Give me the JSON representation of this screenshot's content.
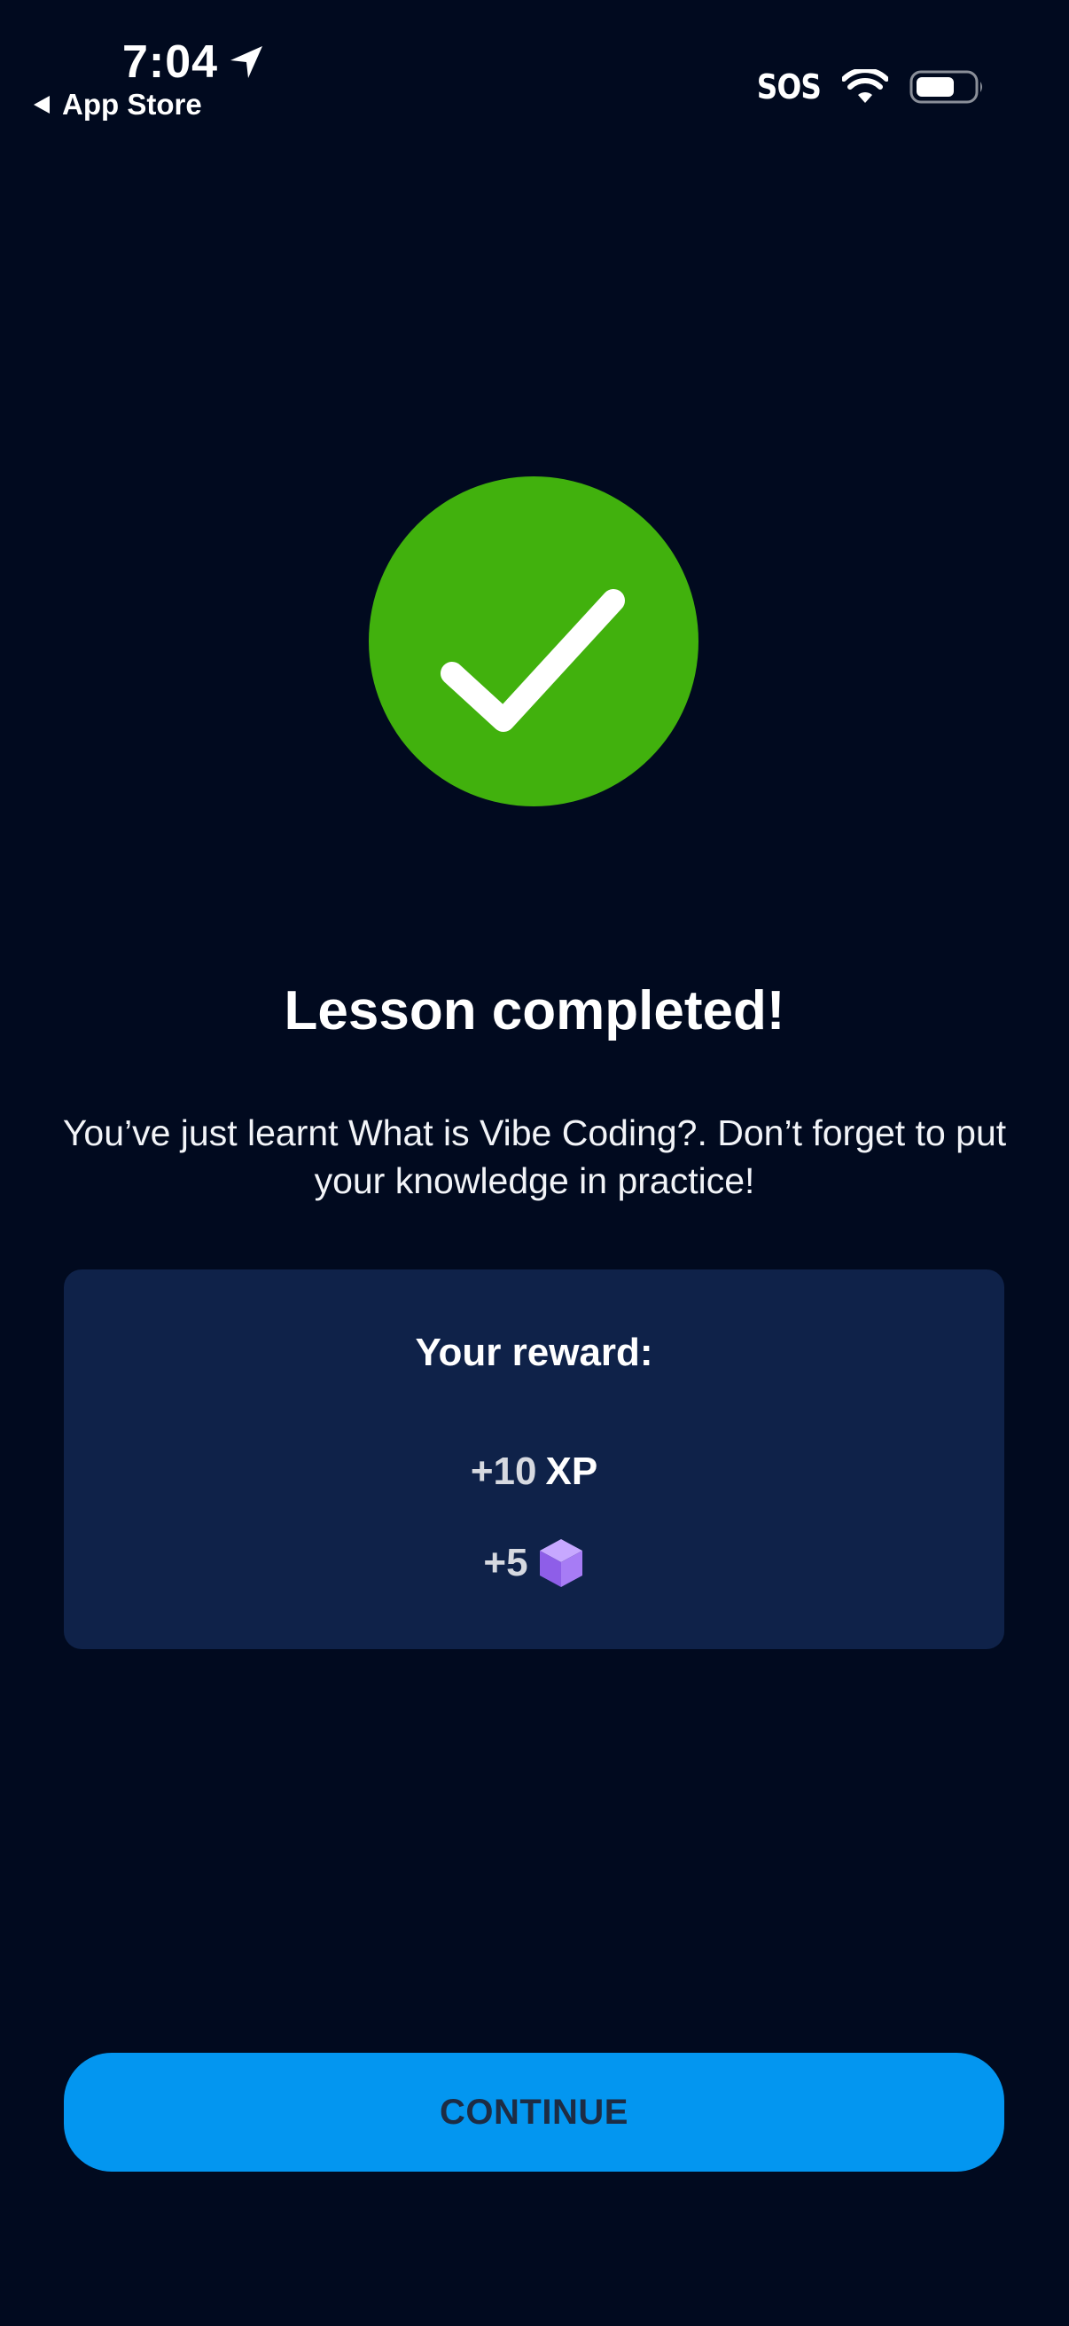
{
  "status_bar": {
    "time": "7:04",
    "back_label": "App Store",
    "sos": "SOS"
  },
  "icons": {
    "location": "location-arrow-icon",
    "back": "back-triangle-icon",
    "wifi": "wifi-icon",
    "battery": "battery-icon",
    "success": "checkmark-icon",
    "gem": "purple-cube-icon"
  },
  "lesson": {
    "title": "Lesson completed!",
    "message": "You’ve just learnt What is Vibe Coding?. Don’t forget to put your knowledge in practice!"
  },
  "reward": {
    "title": "Your reward:",
    "xp_amount": "+10",
    "xp_unit": "XP",
    "gem_amount": "+5"
  },
  "actions": {
    "continue_label": "CONTINUE"
  },
  "colors": {
    "background": "#010a1f",
    "success_green": "#41b10d",
    "card": "#0f2249",
    "button": "#0396f0",
    "button_text": "#1d2c44",
    "gem_purple": "#9b6ef2"
  }
}
